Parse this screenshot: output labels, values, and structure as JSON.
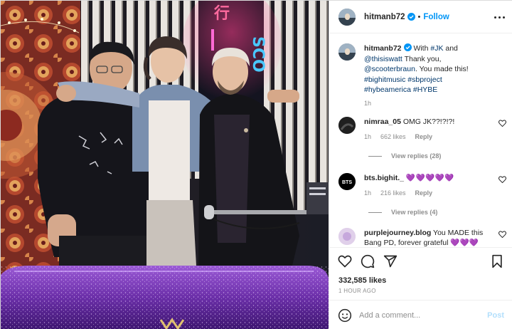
{
  "post": {
    "username": "hitmanb72",
    "follow_label": "Follow",
    "separator": "•",
    "more_icon": "more-horizontal-icon",
    "photo_sign": "SCO"
  },
  "caption": {
    "username": "hitmanb72",
    "text_1": "With ",
    "tag_1": "#JK",
    "text_2": " and",
    "mention_1": "@thisiswatt",
    "text_3": " Thank you,",
    "mention_2": "@scooterbraun",
    "text_4": ". You made this!",
    "tag_2": "#bighitmusic",
    "tag_3": "#sbproject",
    "tag_4": "#hybeamerica",
    "tag_5": "#HYBE",
    "time": "1h"
  },
  "comments": [
    {
      "username": "nimraa_05",
      "text": "OMG JK??!?!?!",
      "time": "1h",
      "likes": "662 likes",
      "reply_label": "Reply",
      "view_replies": "View replies (28)"
    },
    {
      "username": "bts.bighit._",
      "avatar_text": "BTS",
      "text": "💜💜💜💜💜",
      "time": "1h",
      "likes": "216 likes",
      "reply_label": "Reply",
      "view_replies": "View replies (4)"
    },
    {
      "username": "purplejourney.blog",
      "text": "You MADE this",
      "text_2": "Bang PD, forever grateful 💜💜💜"
    }
  ],
  "actions": {
    "like_icon": "heart-icon",
    "comment_icon": "comment-icon",
    "share_icon": "send-icon",
    "save_icon": "bookmark-icon",
    "likes": "332,585 likes",
    "time_ago": "1 HOUR AGO"
  },
  "add_comment": {
    "placeholder": "Add a comment...",
    "post_label": "Post",
    "emoji_icon": "smiley-icon"
  },
  "colors": {
    "accent": "#0095f6",
    "hashtag": "#00376b",
    "muted": "#8e8e8e",
    "post_disabled": "#b2dffc"
  }
}
